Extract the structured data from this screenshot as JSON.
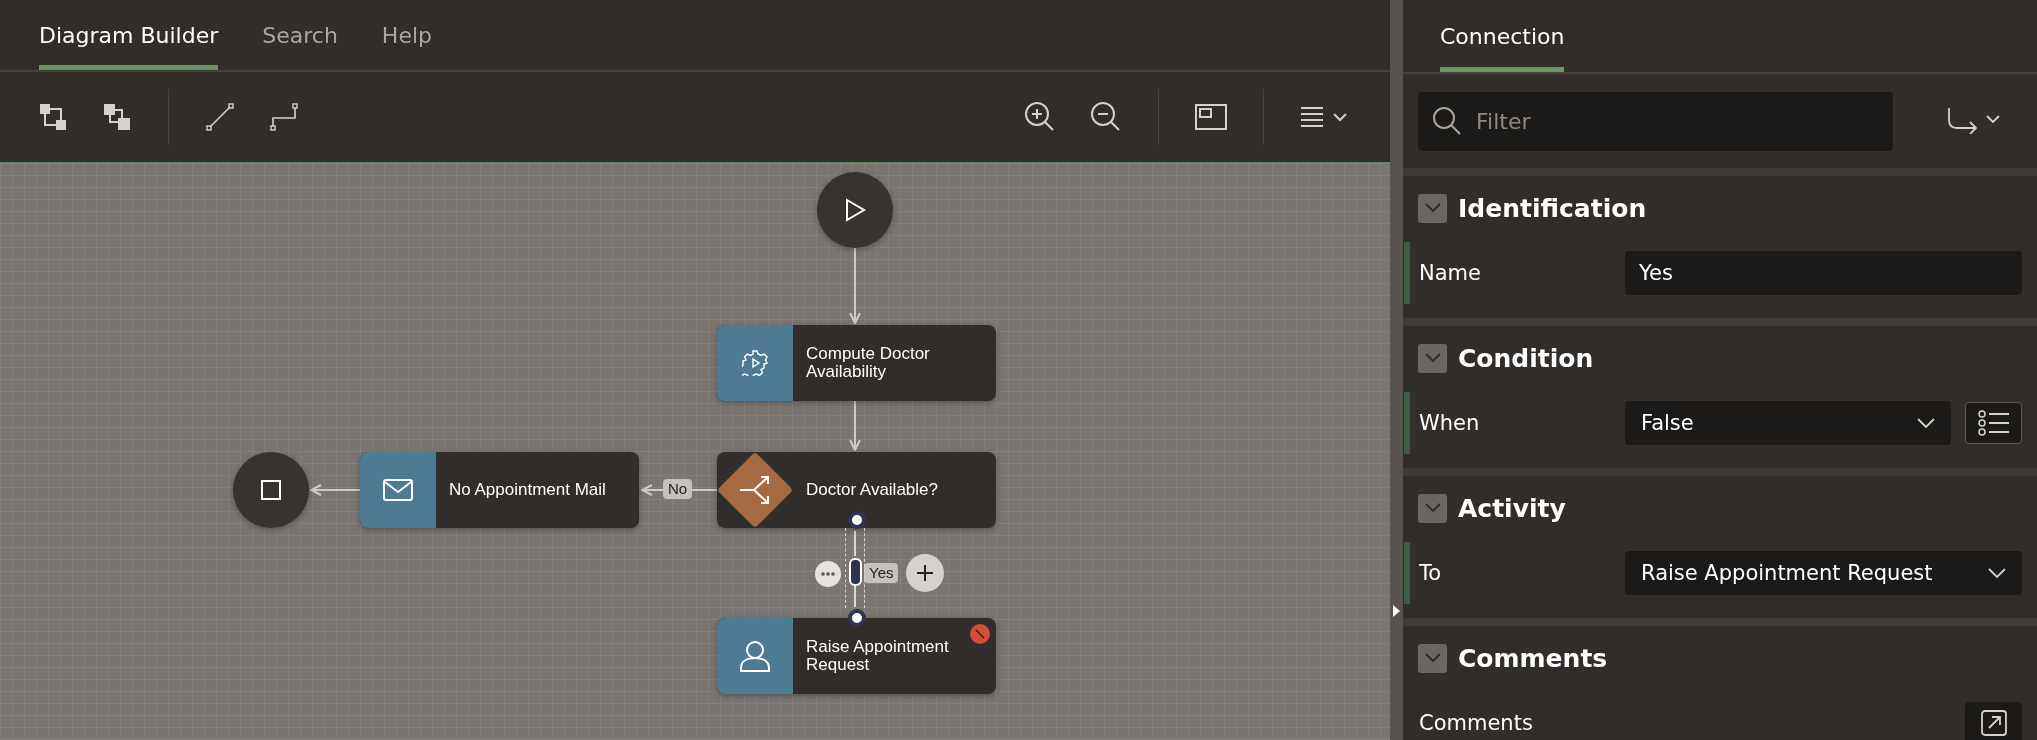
{
  "tabs": [
    {
      "label": "Diagram Builder",
      "selected": true
    },
    {
      "label": "Search",
      "selected": false
    },
    {
      "label": "Help",
      "selected": false
    }
  ],
  "diagram": {
    "nodes": [
      {
        "kind": "start"
      },
      {
        "kind": "service",
        "label": "Compute Doctor Availability",
        "error": false
      },
      {
        "kind": "end"
      },
      {
        "kind": "mail",
        "label": "No Appointment Mail",
        "error": false
      },
      {
        "kind": "decision",
        "label": "Doctor Available?",
        "error": false
      },
      {
        "kind": "human",
        "label": "Raise Appointment Request",
        "error": true
      }
    ],
    "connections": [
      {
        "label": "No",
        "selected": false
      },
      {
        "label": "Yes",
        "selected": true
      }
    ]
  },
  "panel": {
    "tabs": [
      {
        "label": "Connection",
        "selected": true
      }
    ],
    "filter": {
      "placeholder": "Filter"
    },
    "sections": [
      {
        "title": "Identification",
        "expanded": true,
        "fields": [
          {
            "label": "Name",
            "kind": "text",
            "value": "Yes",
            "required": true
          }
        ]
      },
      {
        "title": "Condition",
        "expanded": true,
        "fields": [
          {
            "label": "When",
            "kind": "select_list",
            "value": "False",
            "required": true
          }
        ]
      },
      {
        "title": "Activity",
        "expanded": true,
        "fields": [
          {
            "label": "To",
            "kind": "select",
            "value": "Raise Appointment Request",
            "required": true
          }
        ]
      },
      {
        "title": "Comments",
        "expanded": true,
        "fields": [
          {
            "label": "Comments",
            "kind": "editor",
            "required": false
          }
        ]
      }
    ]
  }
}
